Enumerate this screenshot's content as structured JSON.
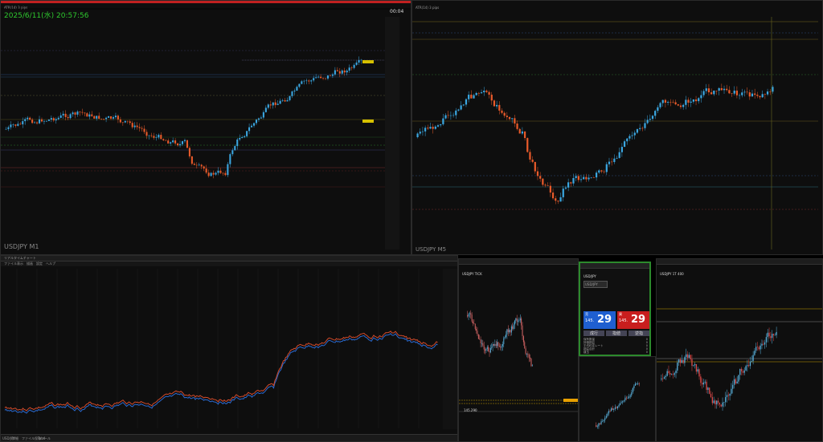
{
  "top_left": {
    "header": "ATR(14) 3 pips",
    "datetime": "2025/6/11(水) 20:57:56",
    "countdown": "00:04",
    "symbol": "USDJPY M1",
    "accent": "#e83030"
  },
  "top_right": {
    "header": "ATR(14) 3 pips",
    "symbol": "USDJPY M5"
  },
  "bottom_left": {
    "title": "リアルタイムチャート",
    "toolbar": [
      "ファイル",
      "表示",
      "描画",
      "設定",
      "ヘルプ"
    ],
    "tabs": [
      "USD/JPY",
      "詳細",
      "ファイル保存ツール",
      "Tab4"
    ]
  },
  "pane_b": {
    "title": "USDJPY TICK",
    "price_label": "145.290"
  },
  "order_panel": {
    "title": "USD/JPY",
    "symbol": "USD/JPY",
    "bid_label": "売",
    "ask_label": "買",
    "bid_price": "29",
    "ask_price": "29",
    "bid_prefix": "145.",
    "ask_prefix": "145.",
    "buttons": [
      "成行",
      "指値",
      "逆指"
    ],
    "rows": [
      "保有数量",
      "評価損益",
      "平均約定レート",
      "損益合計",
      "建玉"
    ],
    "zero": "0"
  },
  "pane_d": {
    "title": "USDJPY 1T 400"
  },
  "colors": {
    "up": "#3aa6e0",
    "down": "#e85a2a",
    "panel": "#0e0e0e"
  }
}
